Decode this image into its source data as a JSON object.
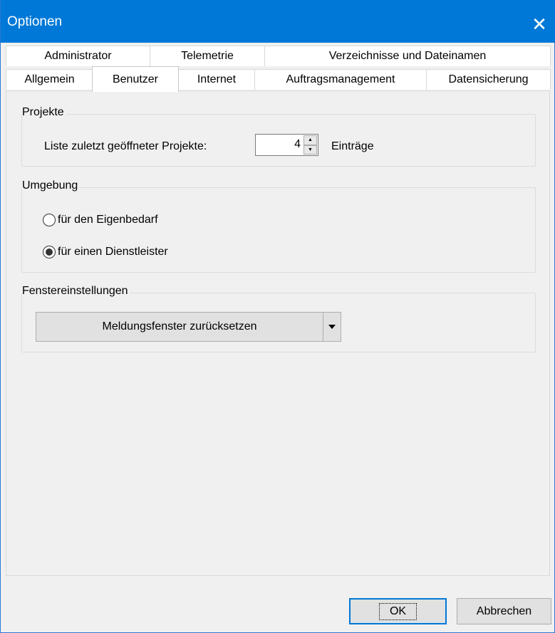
{
  "window": {
    "title": "Optionen",
    "close_glyph": "✕"
  },
  "tabs": {
    "back_row": [
      "Administrator",
      "Telemetrie",
      "Verzeichnisse und Dateinamen"
    ],
    "front_row": [
      "Allgemein",
      "Benutzer",
      "Internet",
      "Auftragsmanagement",
      "Datensicherung"
    ],
    "selected": "Benutzer"
  },
  "projekte": {
    "legend": "Projekte",
    "list_label": "Liste zuletzt geöffneter Projekte:",
    "value": "4",
    "unit": "Einträge",
    "up_glyph": "▲",
    "down_glyph": "▼"
  },
  "umgebung": {
    "legend": "Umgebung",
    "options": [
      {
        "label": "für den Eigenbedarf",
        "checked": false
      },
      {
        "label": "für einen Dienstleister",
        "checked": true
      }
    ]
  },
  "fenster": {
    "legend": "Fenstereinstellungen",
    "button_label": "Meldungsfenster zurücksetzen"
  },
  "footer": {
    "ok_label": "OK",
    "cancel_label": "Abbrechen"
  },
  "colors": {
    "titlebar": "#0078d7",
    "accent_border": "#0078d7"
  }
}
